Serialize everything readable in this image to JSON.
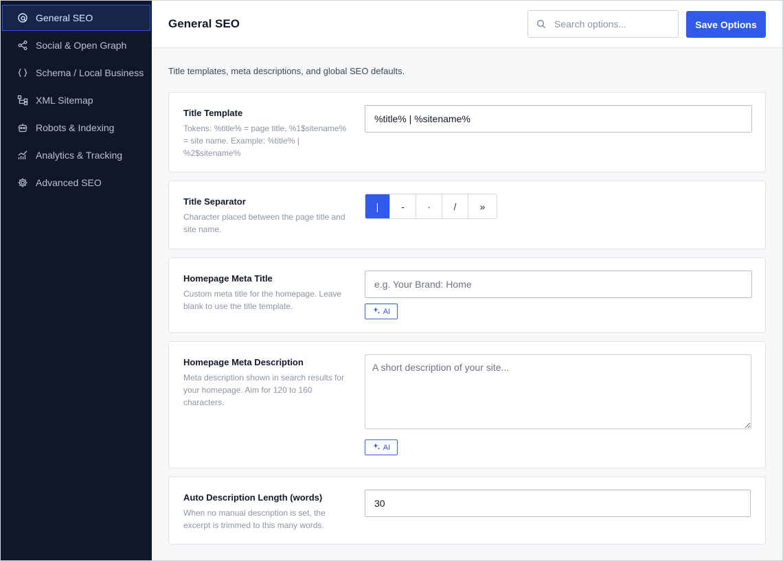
{
  "sidebar": {
    "items": [
      {
        "label": "General SEO",
        "icon": "seo-search-icon",
        "active": true
      },
      {
        "label": "Social & Open Graph",
        "icon": "share-icon"
      },
      {
        "label": "Schema / Local Business",
        "icon": "braces-icon"
      },
      {
        "label": "XML Sitemap",
        "icon": "sitemap-icon"
      },
      {
        "label": "Robots & Indexing",
        "icon": "robot-icon"
      },
      {
        "label": "Analytics & Tracking",
        "icon": "analytics-icon"
      },
      {
        "label": "Advanced SEO",
        "icon": "gear-icon"
      }
    ]
  },
  "header": {
    "title": "General SEO",
    "search_placeholder": "Search options...",
    "save_label": "Save Options"
  },
  "intro": "Title templates, meta descriptions, and global SEO defaults.",
  "fields": {
    "title_template": {
      "label": "Title Template",
      "description": "Tokens: %title% = page title, %1$sitename% = site name. Example: %title% | %2$sitename%",
      "value": "%title% | %sitename%"
    },
    "title_separator": {
      "label": "Title Separator",
      "description": "Character placed between the page title and site name.",
      "options": [
        "|",
        "-",
        "·",
        "/",
        "»"
      ],
      "selected": "|"
    },
    "homepage_meta_title": {
      "label": "Homepage Meta Title",
      "description": "Custom meta title for the homepage. Leave blank to use the title template.",
      "placeholder": "e.g. Your Brand: Home",
      "ai_label": "AI"
    },
    "homepage_meta_description": {
      "label": "Homepage Meta Description",
      "description": "Meta description shown in search results for your homepage. Aim for 120 to 160 characters.",
      "placeholder": "A short description of your site...",
      "ai_label": "AI"
    },
    "auto_description_length": {
      "label": "Auto Description Length (words)",
      "description": "When no manual description is set, the excerpt is trimmed to this many words.",
      "value": "30"
    }
  },
  "colors": {
    "sidebar_bg": "#0f172a",
    "accent": "#2f5be8",
    "page_bg": "#f6f7f9"
  }
}
